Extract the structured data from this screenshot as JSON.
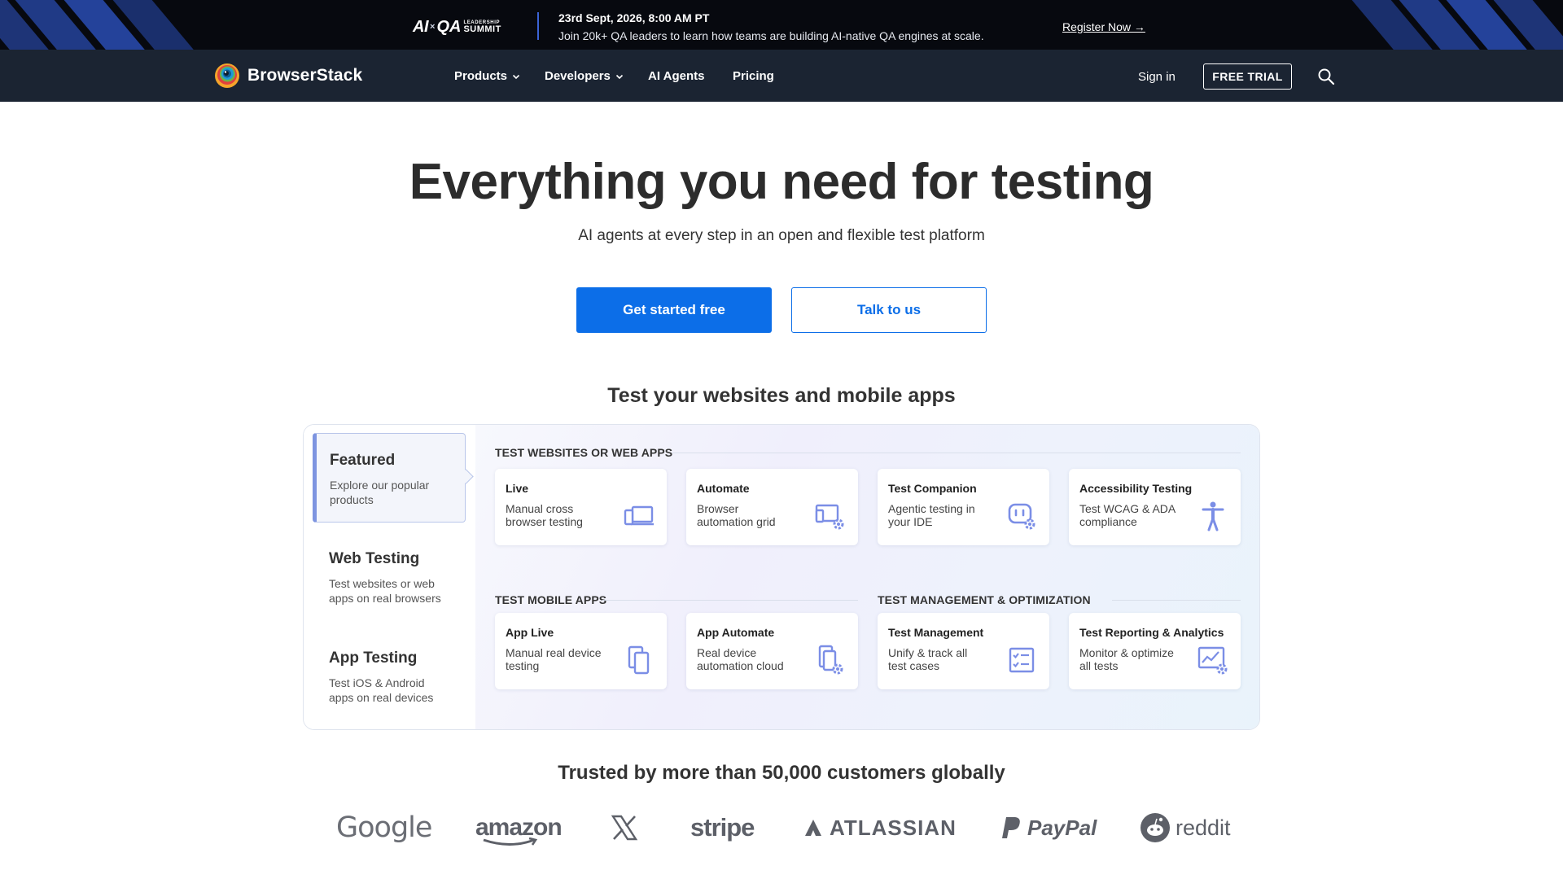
{
  "banner": {
    "summit_ai": "AI",
    "summit_x": "×",
    "summit_qa": "QA",
    "summit_leadership": "LEADERSHIP",
    "summit_summit": "SUMMIT",
    "date": "23rd Sept, 2026, 8:00 AM PT",
    "text": "Join 20k+ QA leaders to learn how teams are building AI-native QA engines at scale.",
    "link": "Register Now →"
  },
  "nav": {
    "brand": "BrowserStack",
    "items": [
      "Products",
      "Developers",
      "AI Agents",
      "Pricing"
    ],
    "sign_in": "Sign in",
    "free_trial": "FREE TRIAL"
  },
  "hero": {
    "title": "Everything you need for testing",
    "subtitle": "AI agents at every step in an open and flexible test platform",
    "primary_cta": "Get started free",
    "secondary_cta": "Talk to us"
  },
  "products": {
    "section_title": "Test your websites and mobile apps",
    "tabs": [
      {
        "title": "Featured",
        "desc": "Explore our popular products"
      },
      {
        "title": "Web Testing",
        "desc": "Test websites or web apps on real browsers"
      },
      {
        "title": "App Testing",
        "desc": "Test iOS & Android apps on real devices"
      }
    ],
    "categories": {
      "web": "TEST WEBSITES OR WEB APPS",
      "mobile": "TEST MOBILE APPS",
      "management": "TEST MANAGEMENT & OPTIMIZATION"
    },
    "cards": [
      {
        "title": "Live",
        "desc": "Manual cross browser testing",
        "icon": "desktop-mobile-icon"
      },
      {
        "title": "Automate",
        "desc": "Browser automation grid",
        "icon": "automation-gear-icon"
      },
      {
        "title": "Test Companion",
        "desc": "Agentic testing in your IDE",
        "icon": "robot-gear-icon"
      },
      {
        "title": "Accessibility Testing",
        "desc": "Test WCAG & ADA compliance",
        "icon": "accessibility-icon"
      },
      {
        "title": "App Live",
        "desc": "Manual real device testing",
        "icon": "devices-icon"
      },
      {
        "title": "App Automate",
        "desc": "Real device automation cloud",
        "icon": "device-gear-icon"
      },
      {
        "title": "Test Management",
        "desc": "Unify & track all test cases",
        "icon": "checklist-icon"
      },
      {
        "title": "Test Reporting & Analytics",
        "desc": "Monitor & optimize all tests",
        "icon": "chart-gear-icon"
      }
    ],
    "icon_color": "#7b8ee6"
  },
  "customers": {
    "title": "Trusted by more than 50,000 customers globally",
    "logos": [
      "Google",
      "amazon",
      "X",
      "stripe",
      "ATLASSIAN",
      "PayPal",
      "reddit"
    ]
  },
  "colors": {
    "banner_bg": "#07090f",
    "nav_bg": "#1b2432",
    "primary": "#0c6ee8",
    "text_dark": "#2c2c2c"
  }
}
